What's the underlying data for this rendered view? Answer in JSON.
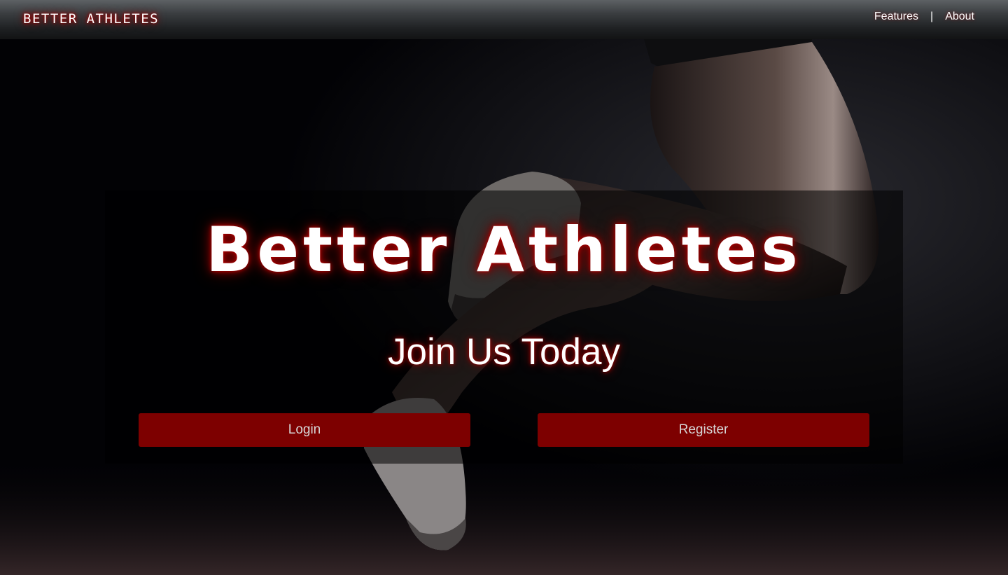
{
  "navbar": {
    "brand": "BETTER ATHLETES",
    "links": [
      {
        "label": "Features"
      },
      {
        "label": "About"
      }
    ],
    "separator": "|"
  },
  "hero": {
    "title": "Better Athletes",
    "subtitle": "Join Us Today",
    "buttons": {
      "login": "Login",
      "register": "Register"
    }
  },
  "colors": {
    "button_bg": "#7d0000",
    "glow": "#c00000",
    "navbar_top": "#5d6164",
    "navbar_bottom": "#121314"
  }
}
